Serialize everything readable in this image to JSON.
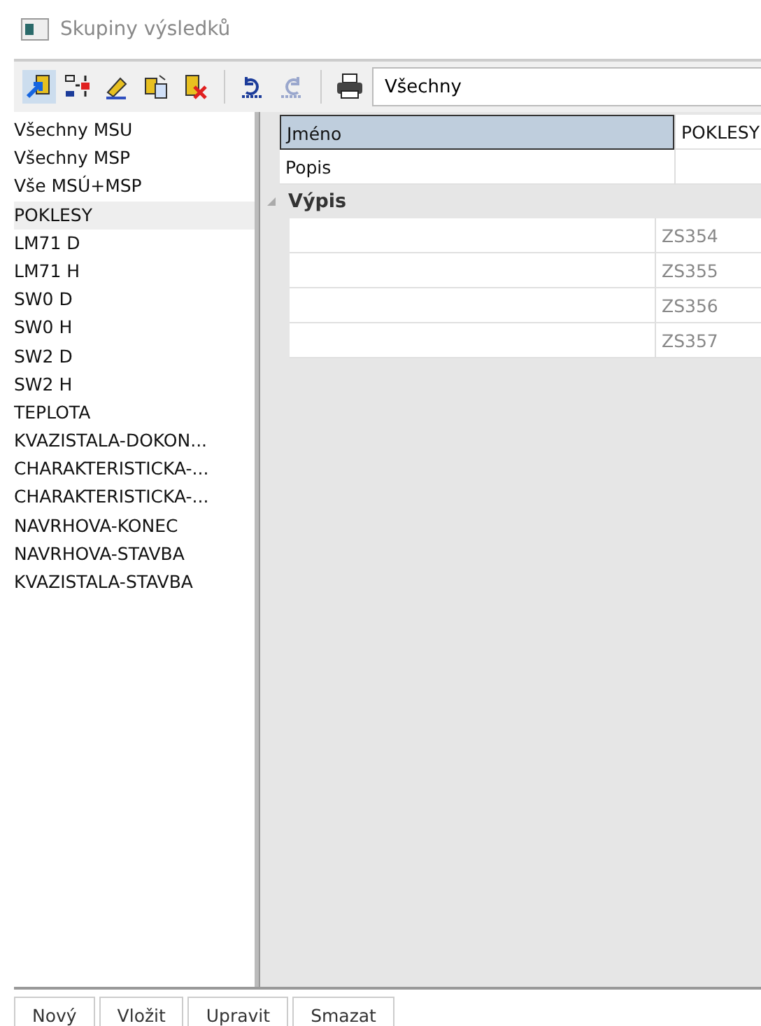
{
  "window": {
    "title": "Skupiny výsledků"
  },
  "toolbar": {
    "tools": [
      {
        "kind": "pick",
        "selected": true,
        "disabled": false
      },
      {
        "kind": "move",
        "selected": false,
        "disabled": false
      },
      {
        "kind": "edit",
        "selected": false,
        "disabled": false
      },
      {
        "kind": "copy",
        "selected": false,
        "disabled": false
      },
      {
        "kind": "delete",
        "selected": false,
        "disabled": false
      },
      {
        "kind": "undo",
        "selected": false,
        "disabled": false
      },
      {
        "kind": "redo",
        "selected": false,
        "disabled": true
      },
      {
        "kind": "print",
        "selected": false,
        "disabled": false
      }
    ],
    "filter": {
      "value": "Všechny"
    }
  },
  "groups": [
    {
      "label": "Všechny MSU",
      "selected": false
    },
    {
      "label": "Všechny MSP",
      "selected": false
    },
    {
      "label": "Vše MSÚ+MSP",
      "selected": false
    },
    {
      "label": "POKLESY",
      "selected": true
    },
    {
      "label": "LM71 D",
      "selected": false
    },
    {
      "label": "LM71 H",
      "selected": false
    },
    {
      "label": "SW0 D",
      "selected": false
    },
    {
      "label": "SW0 H",
      "selected": false
    },
    {
      "label": "SW2 D",
      "selected": false
    },
    {
      "label": "SW2 H",
      "selected": false
    },
    {
      "label": "TEPLOTA",
      "selected": false
    },
    {
      "label": "KVAZISTALA-DOKON...",
      "selected": false
    },
    {
      "label": "CHARAKTERISTICKA-...",
      "selected": false
    },
    {
      "label": "CHARAKTERISTICKA-...",
      "selected": false
    },
    {
      "label": "NAVRHOVA-KONEC",
      "selected": false
    },
    {
      "label": "NAVRHOVA-STAVBA",
      "selected": false
    },
    {
      "label": "KVAZISTALA-STAVBA",
      "selected": false
    }
  ],
  "properties": {
    "rows": [
      {
        "name": "Jméno",
        "value": "POKLESY",
        "selected": true
      },
      {
        "name": "Popis",
        "selected": false
      }
    ],
    "category": {
      "title": "Výpis",
      "expanded": true,
      "rows": [
        {
          "value": "ZS354"
        },
        {
          "value": "ZS355"
        },
        {
          "value": "ZS356"
        },
        {
          "value": "ZS357"
        }
      ]
    }
  },
  "buttons": [
    "Nový",
    "Vložit",
    "Upravit",
    "Smazat"
  ]
}
